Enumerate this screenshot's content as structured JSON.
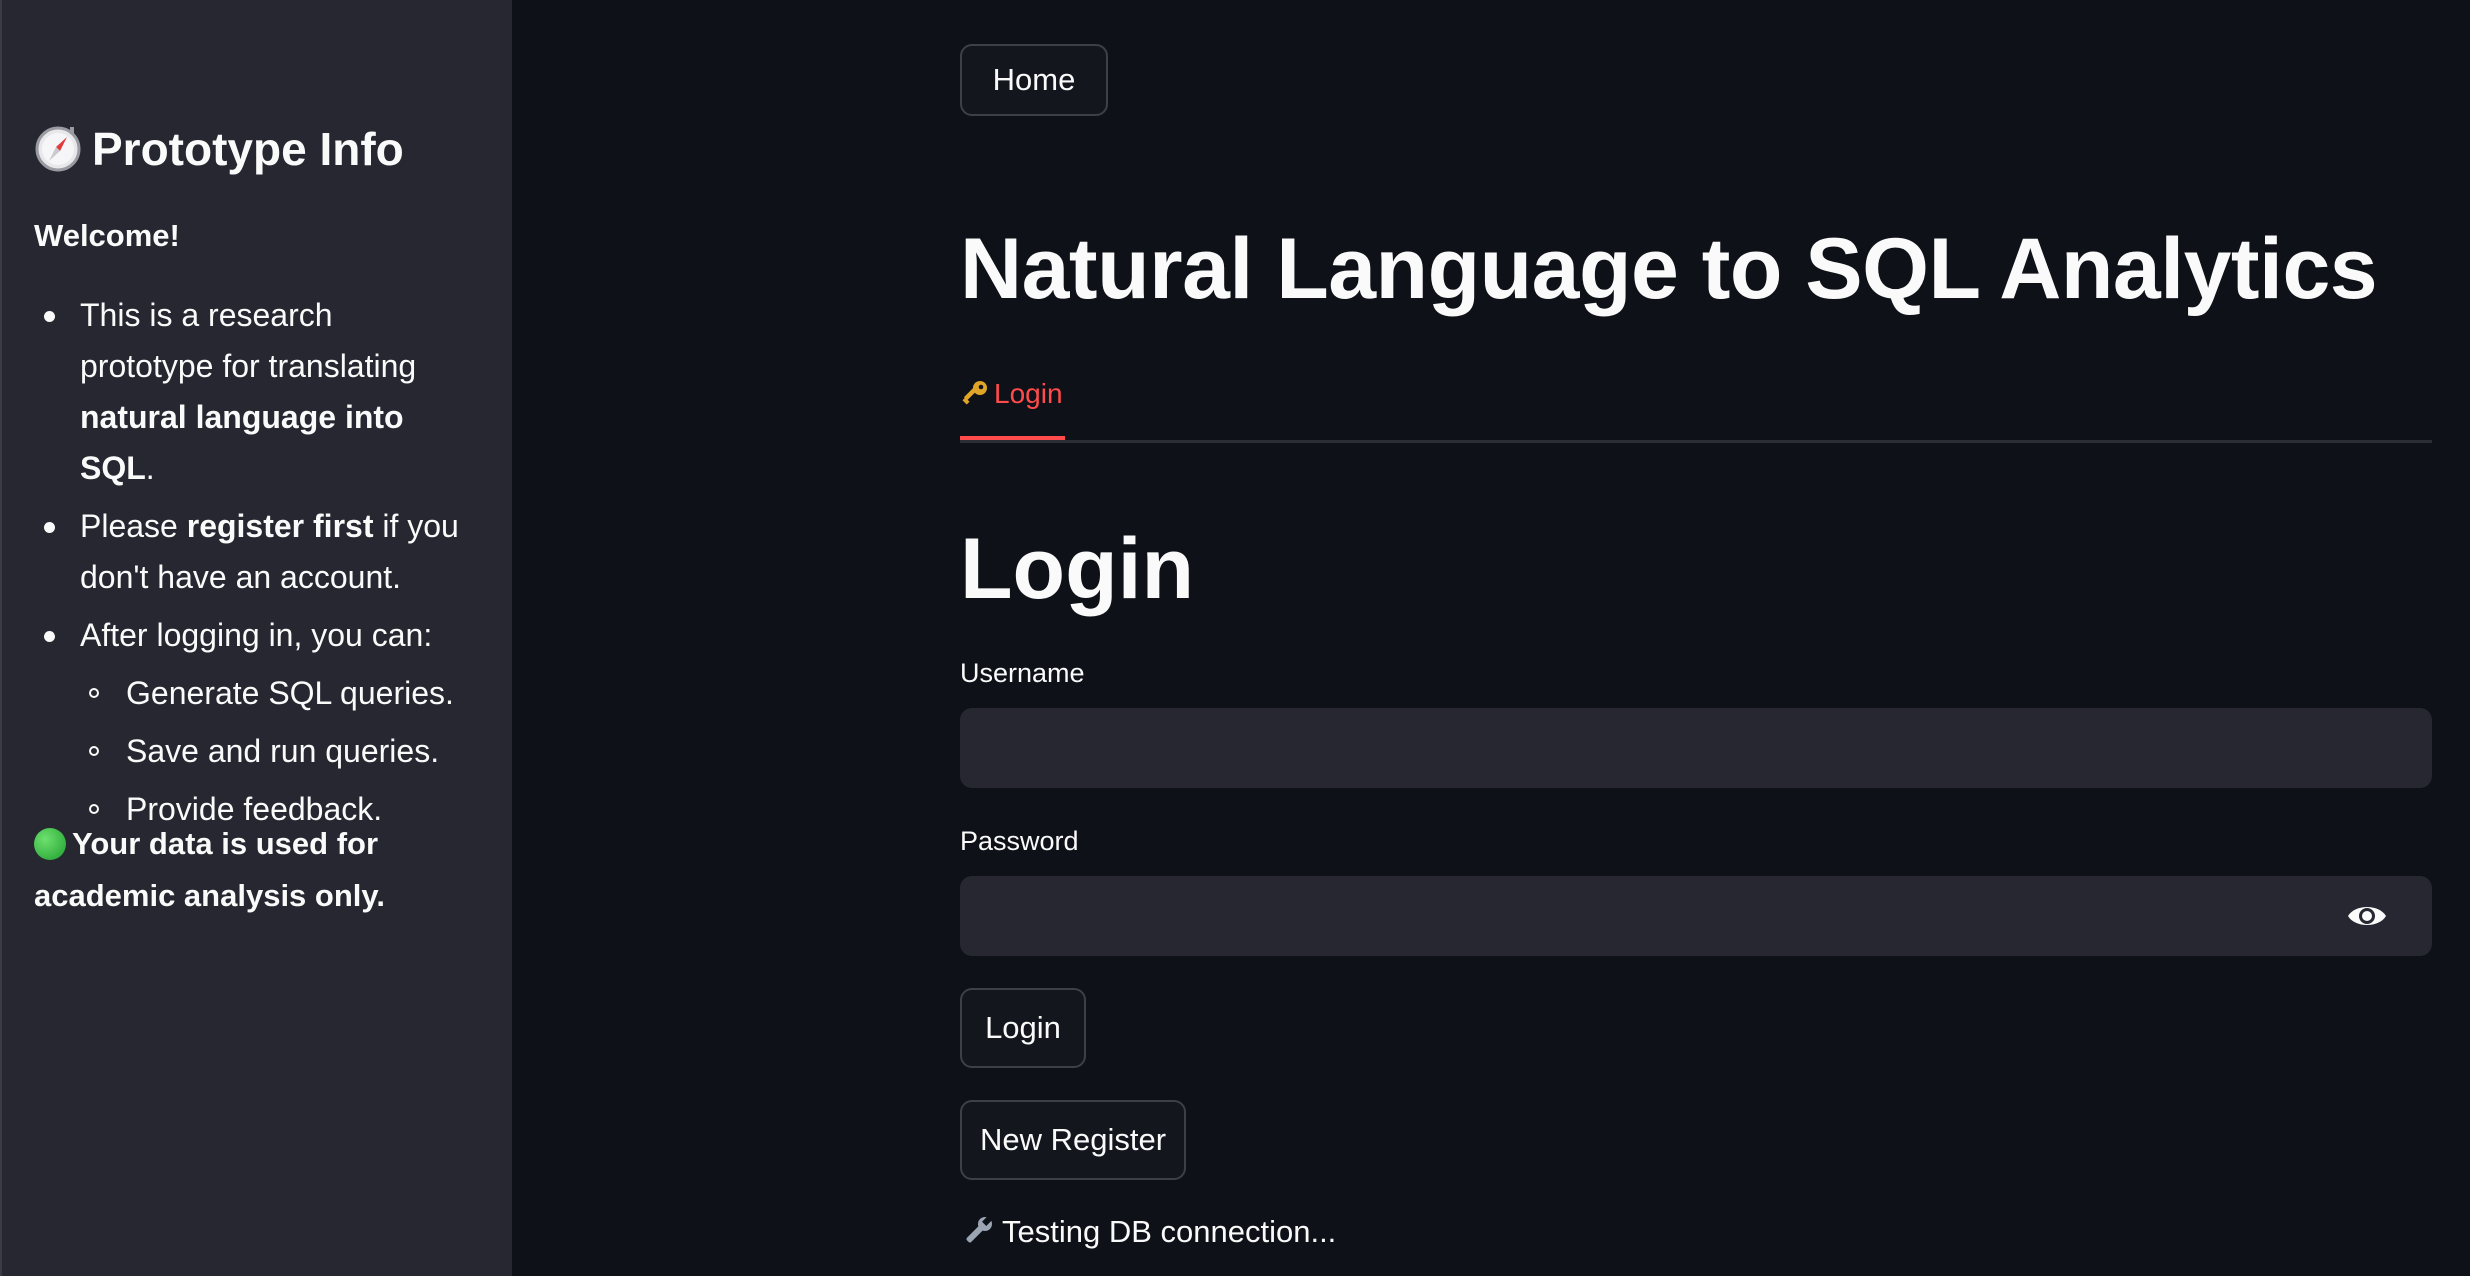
{
  "sidebar": {
    "title": "Prototype Info",
    "welcome": "Welcome!",
    "items": [
      {
        "pre": "This is a research prototype for translating ",
        "bold": "natural language into SQL",
        "post": "."
      },
      {
        "pre": "Please ",
        "bold": "register first",
        "post": " if you don't have an account."
      },
      {
        "pre": "After logging in, you can:",
        "bold": "",
        "post": ""
      }
    ],
    "subitems": [
      "Generate SQL queries.",
      "Save and run queries.",
      "Provide feedback."
    ],
    "note": "Your data is used for academic analysis only."
  },
  "header": {
    "home_button": "Home",
    "title": "Natural Language to SQL Analytics"
  },
  "tabs": [
    {
      "label": "Login",
      "active": true
    }
  ],
  "form": {
    "heading": "Login",
    "username_label": "Username",
    "username_value": "",
    "password_label": "Password",
    "password_value": "",
    "login_button": "Login",
    "register_button": "New Register"
  },
  "status": "Testing DB connection...",
  "colors": {
    "background": "#0e1117",
    "sidebar": "#262730",
    "accent": "#ff4b4b",
    "input_bg": "#262730"
  },
  "icons": {
    "sidebar_title": "compass-icon",
    "tab": "key-icon",
    "password_toggle": "eye-icon",
    "status": "wrench-icon",
    "note": "green-circle-icon"
  }
}
